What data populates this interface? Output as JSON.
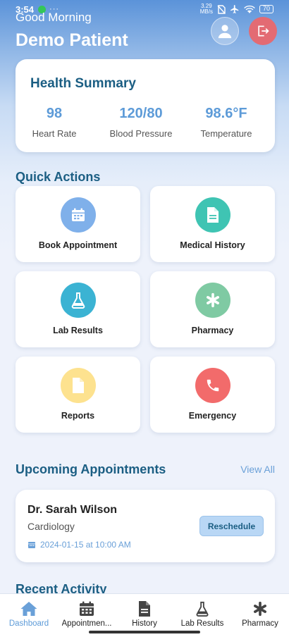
{
  "status_bar": {
    "time": "3:54",
    "net_speed": "3.29",
    "net_unit": "MB/s",
    "battery": "70"
  },
  "header": {
    "greeting": "Good Morning",
    "patient_name": "Demo Patient"
  },
  "health_summary": {
    "title": "Health Summary",
    "metrics": [
      {
        "value": "98",
        "label": "Heart Rate"
      },
      {
        "value": "120/80",
        "label": "Blood Pressure"
      },
      {
        "value": "98.6°F",
        "label": "Temperature"
      }
    ]
  },
  "quick_actions": {
    "title": "Quick Actions",
    "items": [
      {
        "label": "Book Appointment",
        "icon": "calendar-icon",
        "color": "#7fb0ea"
      },
      {
        "label": "Medical History",
        "icon": "document-icon",
        "color": "#3fc4b3"
      },
      {
        "label": "Lab Results",
        "icon": "flask-icon",
        "color": "#3bb3d3"
      },
      {
        "label": "Pharmacy",
        "icon": "asterisk-icon",
        "color": "#7fcaa3"
      },
      {
        "label": "Reports",
        "icon": "file-icon",
        "color": "#fde28f"
      },
      {
        "label": "Emergency",
        "icon": "phone-icon",
        "color": "#f26b6b"
      }
    ]
  },
  "appointments": {
    "title": "Upcoming Appointments",
    "view_all": "View All",
    "items": [
      {
        "doctor": "Dr. Sarah Wilson",
        "specialty": "Cardiology",
        "datetime": "2024-01-15 at 10:00 AM",
        "action": "Reschedule"
      }
    ]
  },
  "recent_activity": {
    "title": "Recent Activity"
  },
  "bottom_nav": {
    "items": [
      {
        "label": "Dashboard",
        "icon": "home-icon",
        "active": true
      },
      {
        "label": "Appointmen...",
        "icon": "calendar-icon",
        "active": false
      },
      {
        "label": "History",
        "icon": "document-icon",
        "active": false
      },
      {
        "label": "Lab Results",
        "icon": "flask-icon",
        "active": false
      },
      {
        "label": "Pharmacy",
        "icon": "asterisk-icon",
        "active": false
      }
    ]
  },
  "colors": {
    "primary": "#1b5e83",
    "accent": "#5d9bd8",
    "logout": "#e36b73"
  }
}
